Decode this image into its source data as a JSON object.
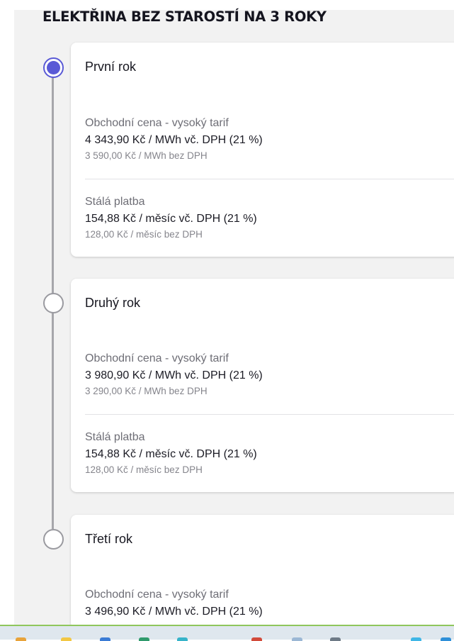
{
  "title": "ELEKTŘINA BEZ STAROSTÍ NA 3 ROKY",
  "years": [
    {
      "label": "První rok",
      "active": true,
      "energy": {
        "label": "Obchodní cena - vysoký tarif",
        "with_vat": "4 343,90 Kč / MWh vč. DPH (21 %)",
        "without_vat": "3 590,00 Kč / MWh bez DPH"
      },
      "fixed": {
        "label": "Stálá platba",
        "with_vat": "154,88 Kč / měsíc vč. DPH (21 %)",
        "without_vat": "128,00 Kč / měsíc bez DPH"
      }
    },
    {
      "label": "Druhý rok",
      "active": false,
      "energy": {
        "label": "Obchodní cena - vysoký tarif",
        "with_vat": "3 980,90 Kč / MWh vč. DPH (21 %)",
        "without_vat": "3 290,00 Kč / MWh bez DPH"
      },
      "fixed": {
        "label": "Stálá platba",
        "with_vat": "154,88 Kč / měsíc vč. DPH (21 %)",
        "without_vat": "128,00 Kč / měsíc bez DPH"
      }
    },
    {
      "label": "Třetí rok",
      "active": false,
      "energy": {
        "label": "Obchodní cena - vysoký tarif",
        "with_vat": "3 496,90 Kč / MWh vč. DPH (21 %)"
      }
    }
  ],
  "colors": {
    "accent": "#5a5ad6",
    "timeline": "#a6a6ab",
    "page_background": "#f2f2f2",
    "card_background": "#ffffff"
  },
  "taskbar": {
    "icons": [
      "taskbar-app-icon-1",
      "taskbar-app-icon-2",
      "taskbar-app-icon-3",
      "taskbar-app-icon-4",
      "taskbar-app-icon-5",
      "taskbar-app-icon-6",
      "taskbar-app-icon-7",
      "taskbar-app-icon-8",
      "taskbar-app-icon-9",
      "taskbar-app-icon-10"
    ]
  }
}
